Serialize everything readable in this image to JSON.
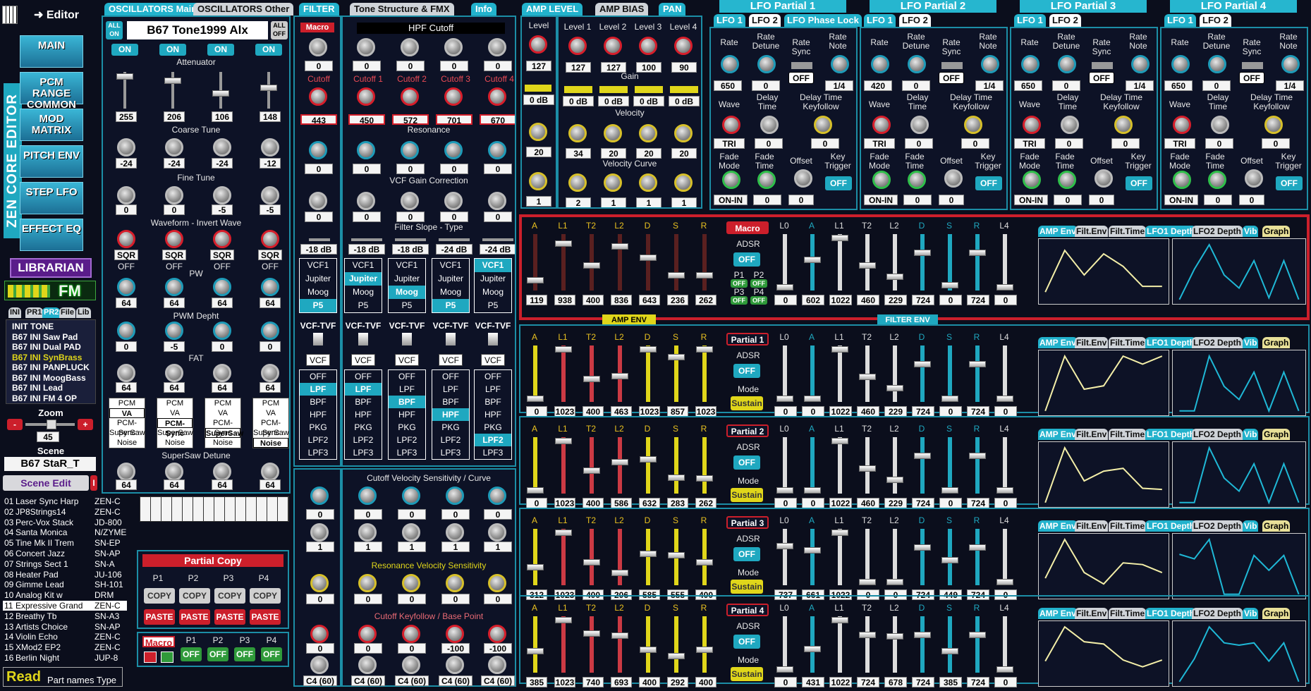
{
  "app": {
    "editor_label": "Editor",
    "vertical_title": "ZEN CORE EDITOR"
  },
  "nav": [
    {
      "label": "MAIN"
    },
    {
      "label": "PCM RANGE COMMON"
    },
    {
      "label": "MOD MATRIX"
    },
    {
      "label": "PITCH ENV"
    },
    {
      "label": "STEP LFO"
    },
    {
      "label": "EFFECT EQ"
    }
  ],
  "librarian_label": "LIBRARIAN",
  "fm_label": "FM",
  "lib_tabs": [
    "INI",
    "PR1",
    "PR2",
    "File",
    "Lib"
  ],
  "presets": [
    "INIT TONE",
    "B67 INI Saw Pad",
    "B67 INI Dual PAD",
    "B67 INI SynBrass",
    "B67 INI PANPLUCK",
    "B67 INI MoogBass",
    "B67 INI Lead",
    "B67 INI FM 4 OP"
  ],
  "zoom": {
    "label": "Zoom",
    "minus": "-",
    "plus": "+",
    "value": "45"
  },
  "scene": {
    "label": "Scene",
    "name": "B67 StaR_T",
    "edit": "Scene Edit",
    "i": "I"
  },
  "scenes": [
    [
      "01",
      "Laser Sync Harp",
      "ZEN-C"
    ],
    [
      "02",
      "JP8Strings14",
      "ZEN-C"
    ],
    [
      "03",
      "Perc-Vox Stack",
      "JD-800"
    ],
    [
      "04",
      "Santa Monica",
      "N/ZYME"
    ],
    [
      "05",
      "Tine Mk II Trem",
      "SN-EP"
    ],
    [
      "06",
      "Concert Jazz",
      "SN-AP"
    ],
    [
      "07",
      "Strings Sect 1",
      "SN-A"
    ],
    [
      "08",
      "Heater Pad",
      "JU-106"
    ],
    [
      "09",
      "Gimme Lead",
      "SH-101"
    ],
    [
      "10",
      "Analog Kit w",
      "DRM"
    ],
    [
      "11",
      "Expressive Grand",
      "ZEN-C"
    ],
    [
      "12",
      "Breathy Tb",
      "SN-A3"
    ],
    [
      "13",
      "Artists Choice",
      "SN-AP"
    ],
    [
      "14",
      "Violin Echo",
      "ZEN-C"
    ],
    [
      "15",
      "XMod2 EP2",
      "ZEN-C"
    ],
    [
      "16",
      "Berlin Night",
      "JUP-8"
    ]
  ],
  "read": {
    "label": "Read",
    "sub": "Part names Type"
  },
  "osc": {
    "tab_main": "OSCILLATORS Main",
    "tab_other": "OSCILLATORS Other",
    "all_on": "ALL ON",
    "all_off": "ALL OFF",
    "tone_name": "B67 Tone1999 Alx",
    "on": "ON",
    "attenuator": "Attenuator",
    "att_vals": [
      "255",
      "206",
      "106",
      "148"
    ],
    "coarse": "Coarse Tune",
    "coarse_vals": [
      "-24",
      "-24",
      "-24",
      "-12"
    ],
    "fine": "Fine Tune",
    "fine_vals": [
      "0",
      "0",
      "-5",
      "-5"
    ],
    "wave": "Waveform - Invert Wave",
    "wave_vals": [
      "SQR",
      "SQR",
      "SQR",
      "SQR"
    ],
    "off": "OFF",
    "pw": "PW",
    "pw_vals": [
      "64",
      "64",
      "64",
      "64"
    ],
    "pwm": "PWM Depht",
    "pwm_vals": [
      "0",
      "-5",
      "0",
      "0"
    ],
    "fat": "FAT",
    "fat_vals": [
      "64",
      "64",
      "64",
      "64"
    ],
    "types": [
      "PCM",
      "VA",
      "PCM-Sync",
      "SuperSaw",
      "Noise"
    ],
    "type_sel": [
      1,
      2,
      3,
      4
    ],
    "ssd": "SuperSaw Detune",
    "ssd_vals": [
      "64",
      "64",
      "64",
      "64"
    ]
  },
  "filter": {
    "tab": "FILTER",
    "tab2": "Tone Structure & FMX",
    "tab3": "Info",
    "macro": "Macro",
    "hpf": "HPF Cutoff",
    "hpf_vals": [
      "0",
      "0",
      "0",
      "0",
      "0"
    ],
    "cutoff_labels": [
      "Cutoff",
      "Cutoff 1",
      "Cutoff 2",
      "Cutoff 3",
      "Cutoff 4"
    ],
    "cutoff_vals": [
      "443",
      "450",
      "572",
      "701",
      "670"
    ],
    "res": "Resonance",
    "res_vals": [
      "0",
      "0",
      "0",
      "0",
      "0"
    ],
    "gain": "VCF Gain Correction",
    "gain_vals": [
      "0",
      "0",
      "0",
      "0",
      "0"
    ],
    "slope": "Filter Slope - Type",
    "slope_vals": [
      "-18 dB",
      "-18 dB",
      "-18 dB",
      "-24 dB",
      "-24 dB"
    ],
    "vcf_types": [
      "VCF1",
      "Jupiter",
      "Moog",
      "P5"
    ],
    "vcf_sel": [
      3,
      1,
      2,
      3,
      0
    ],
    "vcftvf": "VCF-TVF",
    "vcf": "VCF",
    "ftypes": [
      "OFF",
      "LPF",
      "BPF",
      "HPF",
      "PKG",
      "LPF2",
      "LPF3"
    ],
    "ftype_sel": [
      1,
      1,
      2,
      3,
      5
    ],
    "cvs": "Cutoff Velocity Sensitivity / Curve",
    "cvs_vals": [
      "0",
      "0",
      "0",
      "0",
      "0"
    ],
    "cvc_vals": [
      "1",
      "1",
      "1",
      "1",
      "1"
    ],
    "rvs": "Resonance Velocity Sensitivity",
    "rvs_vals": [
      "0",
      "0",
      "0",
      "0",
      "0"
    ],
    "ckf": "Cutoff Keyfollow / Base Point",
    "ckf_vals": [
      "0",
      "0",
      "0",
      "-100",
      "-100"
    ],
    "bp_vals": [
      "C4 (60)",
      "C4 (60)",
      "C4 (60)",
      "C4 (60)",
      "C4 (60)"
    ]
  },
  "partial_copy": {
    "title": "Partial Copy",
    "parts": [
      "P1",
      "P2",
      "P3",
      "P4"
    ],
    "copy": "COPY",
    "paste": "PASTE",
    "macro": "Macro",
    "off": "OFF"
  },
  "amp": {
    "tab1": "AMP LEVEL",
    "tab2": "AMP BIAS",
    "tab3": "PAN",
    "level_labels": [
      "Level",
      "Level 1",
      "Level 2",
      "Level 3",
      "Level 4"
    ],
    "level_vals": [
      "127",
      "127",
      "127",
      "100",
      "90"
    ],
    "gain": "Gain",
    "gain_vals": [
      "0 dB",
      "0 dB",
      "0 dB",
      "0 dB",
      "0 dB"
    ],
    "vel": "Velocity",
    "vel_vals": [
      "20",
      "34",
      "20",
      "20",
      "20"
    ],
    "vc": "Velocity Curve",
    "vc_vals": [
      "1",
      "2",
      "1",
      "1",
      "1"
    ]
  },
  "lfo": [
    {
      "title": "LFO Partial 1",
      "tabs": [
        "LFO 1",
        "LFO 2",
        "LFO Phase Lock"
      ],
      "rate": "650",
      "rdet": "0",
      "note": "1/4",
      "wave": "TRI",
      "delay": "0",
      "dtk": "0",
      "fade": "ON-IN",
      "ftime": "0",
      "offset": "0"
    },
    {
      "title": "LFO Partial 2",
      "tabs": [
        "LFO 1",
        "LFO 2"
      ],
      "rate": "420",
      "rdet": "0",
      "note": "1/4",
      "wave": "TRI",
      "delay": "0",
      "dtk": "0",
      "fade": "ON-IN",
      "ftime": "0",
      "offset": "0"
    },
    {
      "title": "LFO Partial 3",
      "tabs": [
        "LFO 1",
        "LFO 2"
      ],
      "rate": "650",
      "rdet": "0",
      "note": "1/4",
      "wave": "TRI",
      "delay": "0",
      "dtk": "0",
      "fade": "ON-IN",
      "ftime": "0",
      "offset": "0"
    },
    {
      "title": "LFO Partial 4",
      "tabs": [
        "LFO 1",
        "LFO 2"
      ],
      "rate": "650",
      "rdet": "0",
      "note": "1/4",
      "wave": "TRI",
      "delay": "0",
      "dtk": "0",
      "fade": "ON-IN",
      "ftime": "0",
      "offset": "0"
    }
  ],
  "lfo_labels": {
    "rate": "Rate",
    "rdet": "Rate Detune",
    "sync": "Rate Sync",
    "note": "Rate Note",
    "off": "OFF",
    "wave": "Wave",
    "delay": "Delay Time",
    "dtk": "Delay Time Keyfollow",
    "fade": "Fade Mode",
    "ftime": "Fade Time",
    "offset": "Offset",
    "ktrig": "Key Trigger"
  },
  "env": {
    "amp_labels": [
      "A",
      "L1",
      "T2",
      "L2",
      "D",
      "S",
      "R"
    ],
    "filt_labels": [
      "L0",
      "A",
      "L1",
      "T2",
      "L2",
      "D",
      "S",
      "R",
      "L4"
    ],
    "adsr": "ADSR",
    "mode": "Mode",
    "sustain": "Sustain",
    "amp_env": "AMP ENV",
    "filter_env": "FILTER ENV",
    "macro": "Macro",
    "tabs": [
      "AMP Env",
      "Filt.Env",
      "Filt.Time",
      "LFO1 Depth",
      "LFO2 Depth",
      "Vib",
      "Graph"
    ],
    "rows": [
      {
        "title": "Macro",
        "amp": [
          "119",
          "938",
          "400",
          "836",
          "643",
          "236",
          "262"
        ],
        "filt": [
          "0",
          "602",
          "1022",
          "460",
          "229",
          "724",
          "0",
          "724",
          "0"
        ],
        "amp_lv": [
          0.15,
          0.88,
          0.45,
          0.82,
          0.6,
          0.25,
          0.25
        ],
        "filt_lv": [
          0.02,
          0.55,
          0.98,
          0.45,
          0.22,
          0.7,
          0.05,
          0.7,
          0.02
        ]
      },
      {
        "title": "Partial 1",
        "amp": [
          "0",
          "1023",
          "400",
          "463",
          "1023",
          "857",
          "1023"
        ],
        "filt": [
          "0",
          "0",
          "1022",
          "460",
          "229",
          "724",
          "0",
          "724",
          "0"
        ],
        "amp_lv": [
          0.02,
          0.98,
          0.4,
          0.46,
          0.98,
          0.84,
          0.98
        ],
        "filt_lv": [
          0.02,
          0.02,
          0.98,
          0.45,
          0.22,
          0.7,
          0.02,
          0.7,
          0.02
        ]
      },
      {
        "title": "Partial 2",
        "amp": [
          "0",
          "1023",
          "400",
          "586",
          "632",
          "283",
          "262"
        ],
        "filt": [
          "0",
          "0",
          "1022",
          "460",
          "229",
          "724",
          "0",
          "724",
          "0"
        ],
        "amp_lv": [
          0.02,
          0.98,
          0.4,
          0.57,
          0.62,
          0.27,
          0.25
        ],
        "filt_lv": [
          0.02,
          0.02,
          0.98,
          0.45,
          0.22,
          0.7,
          0.02,
          0.7,
          0.02
        ]
      },
      {
        "title": "Partial 3",
        "amp": [
          "312",
          "1023",
          "400",
          "206",
          "585",
          "555",
          "400"
        ],
        "filt": [
          "737",
          "661",
          "1022",
          "0",
          "0",
          "724",
          "449",
          "724",
          "0"
        ],
        "amp_lv": [
          0.3,
          0.98,
          0.4,
          0.2,
          0.57,
          0.54,
          0.4
        ],
        "filt_lv": [
          0.72,
          0.64,
          0.98,
          0.02,
          0.02,
          0.7,
          0.44,
          0.7,
          0.02
        ]
      },
      {
        "title": "Partial 4",
        "amp": [
          "385",
          "1023",
          "740",
          "693",
          "400",
          "292",
          "400"
        ],
        "filt": [
          "0",
          "431",
          "1022",
          "724",
          "678",
          "724",
          "385",
          "724",
          "0"
        ],
        "amp_lv": [
          0.38,
          0.98,
          0.72,
          0.68,
          0.4,
          0.28,
          0.4
        ],
        "filt_lv": [
          0.02,
          0.42,
          0.98,
          0.7,
          0.66,
          0.7,
          0.38,
          0.7,
          0.02
        ]
      }
    ],
    "p_labels": [
      "P1",
      "P2",
      "P3",
      "P4"
    ],
    "off": "OFF"
  }
}
